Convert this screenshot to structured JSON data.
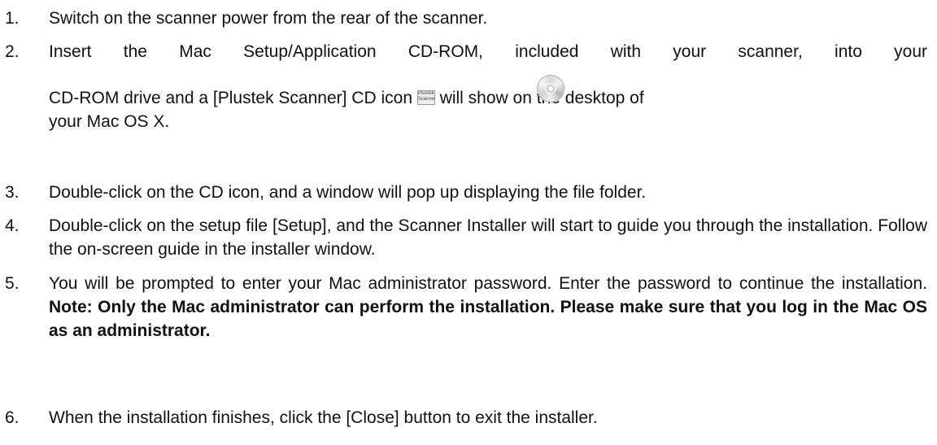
{
  "steps": [
    {
      "num": "1.",
      "text": "Switch on the scanner power from the rear of the scanner."
    },
    {
      "num": "2.",
      "line1": "Insert the Mac Setup/Application CD-ROM, included with your scanner, into your",
      "line2a": "CD-ROM drive and a [Plustek Scanner] CD icon",
      "line2b": "will show on the desktop of",
      "line3": "your Mac OS X.",
      "icon_label": "Plustek Scanner",
      "disc_icon": "cd-disc-icon"
    },
    {
      "num": "3.",
      "text": "Double-click on the CD icon, and a window will pop up displaying the file folder."
    },
    {
      "num": "4.",
      "text": "Double-click on the setup file [Setup], and the Scanner Installer will start to guide you through the installation. Follow the on-screen guide in the installer window."
    },
    {
      "num": "5.",
      "text": "You will be prompted to enter your Mac administrator password. Enter the password to continue the installation.",
      "note": "Note: Only the Mac administrator can perform the installation. Please make sure that you log in the Mac OS as an administrator."
    },
    {
      "num": "6.",
      "text": "When the installation finishes, click the [Close] button to exit the installer."
    }
  ]
}
